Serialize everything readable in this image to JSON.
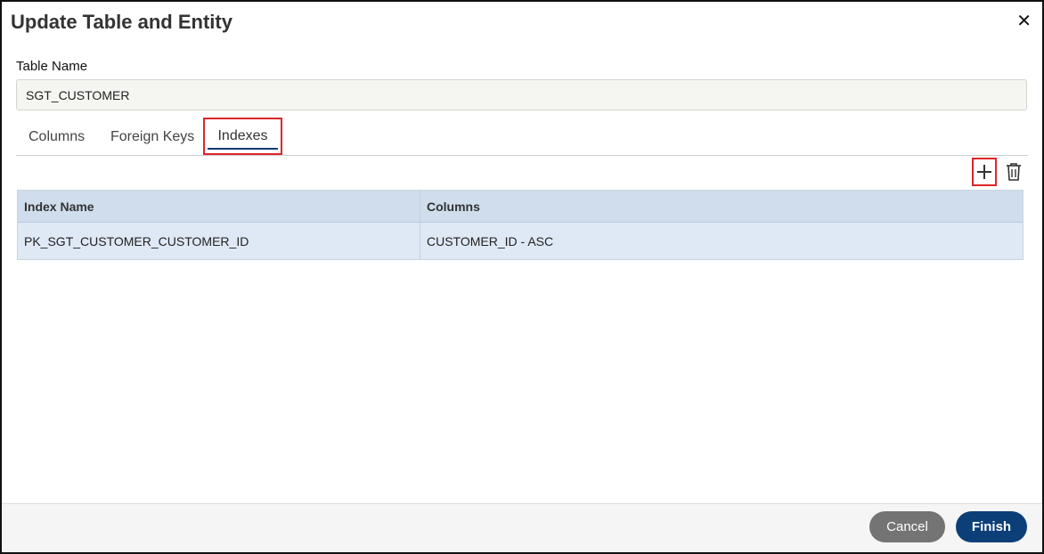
{
  "dialog": {
    "title": "Update Table and Entity",
    "close_icon": "close-icon"
  },
  "table_name": {
    "label": "Table Name",
    "value": "SGT_CUSTOMER"
  },
  "tabs": [
    {
      "label": "Columns",
      "active": false
    },
    {
      "label": "Foreign Keys",
      "active": false
    },
    {
      "label": "Indexes",
      "active": true
    }
  ],
  "toolbar": {
    "add_icon": "plus-icon",
    "delete_icon": "trash-icon"
  },
  "grid": {
    "headers": [
      "Index Name",
      "Columns"
    ],
    "rows": [
      [
        "PK_SGT_CUSTOMER_CUSTOMER_ID",
        "CUSTOMER_ID - ASC"
      ]
    ]
  },
  "footer": {
    "cancel_label": "Cancel",
    "finish_label": "Finish"
  },
  "colors": {
    "highlight_border": "#e0252b",
    "primary": "#0c3f78",
    "grid_header": "#cfddec",
    "grid_row": "#dfe8f5"
  }
}
